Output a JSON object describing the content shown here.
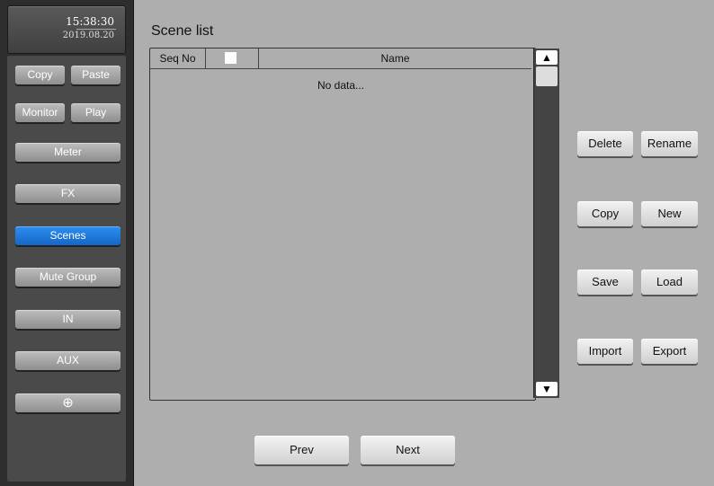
{
  "clock": {
    "time": "15:38:30",
    "date": "2019.08.20"
  },
  "sidebar": {
    "copy": "Copy",
    "paste": "Paste",
    "monitor": "Monitor",
    "play": "Play",
    "meter": "Meter",
    "fx": "FX",
    "scenes": "Scenes",
    "mute_group": "Mute Group",
    "in": "IN",
    "aux": "AUX",
    "settings_icon": "⊕"
  },
  "scene_list": {
    "title": "Scene list",
    "columns": {
      "seq": "Seq No",
      "name": "Name"
    },
    "empty_text": "No data...",
    "scroll_up": "▲",
    "scroll_down": "▼"
  },
  "actions": {
    "delete": "Delete",
    "rename": "Rename",
    "copy": "Copy",
    "new": "New",
    "save": "Save",
    "load": "Load",
    "import": "Import",
    "export": "Export"
  },
  "pager": {
    "prev": "Prev",
    "next": "Next"
  },
  "colors": {
    "active": "#1f7be0",
    "panel": "#aeaeae"
  }
}
